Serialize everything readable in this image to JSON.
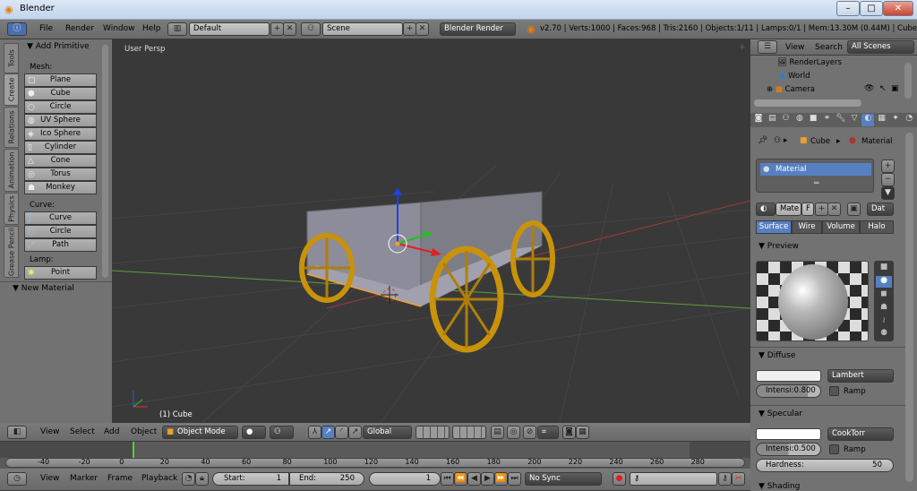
{
  "window": {
    "title": "Blender",
    "controls": [
      "–",
      "□",
      "✕"
    ]
  },
  "info_header": {
    "menus": [
      "File",
      "Render",
      "Window",
      "Help"
    ],
    "layout": "Default",
    "scene": "Scene",
    "engine": "Blender Render",
    "stats": "v2.70 | Verts:1000 | Faces:968 | Tris:2160 | Objects:1/11 | Lamps:0/1 | Mem:13.30M (0.44M) | Cube"
  },
  "tool_shelf": {
    "tabs": [
      "Tools",
      "Create",
      "Relations",
      "Animation",
      "Physics",
      "Grease Pencil"
    ],
    "active_tab": "Create",
    "panel_title": "Add Primitive",
    "mesh_label": "Mesh:",
    "mesh": [
      "Plane",
      "Cube",
      "Circle",
      "UV Sphere",
      "Ico Sphere",
      "Cylinder",
      "Cone",
      "Torus",
      "Monkey"
    ],
    "curve_label": "Curve:",
    "curve": [
      "Curve",
      "Circle",
      "Path"
    ],
    "lamp_label": "Lamp:",
    "lamp": [
      "Point"
    ],
    "new_material": "New Material"
  },
  "viewport": {
    "view_name": "User Persp",
    "object_label": "(1) Cube",
    "colors": {
      "background": "#393939",
      "wood_wheel": "#c8920a",
      "wagon_body": "#8c8c9a"
    }
  },
  "view3d_header": {
    "menus": [
      "View",
      "Select",
      "Add",
      "Object"
    ],
    "mode": "Object Mode",
    "orientation": "Global"
  },
  "timeline": {
    "ticks": [
      "-40",
      "-20",
      "0",
      "20",
      "40",
      "60",
      "80",
      "100",
      "120",
      "140",
      "160",
      "180",
      "200",
      "220",
      "240",
      "260",
      "280"
    ],
    "current_frame_marker": 0,
    "header": {
      "menus": [
        "View",
        "Marker",
        "Frame",
        "Playback"
      ],
      "start_label": "Start:",
      "start": "1",
      "end_label": "End:",
      "end": "250",
      "current": "1",
      "sync": "No Sync"
    }
  },
  "outliner": {
    "menus": [
      "View",
      "Search"
    ],
    "filter": "All Scenes",
    "items": [
      "RenderLayers",
      "World",
      "Camera"
    ]
  },
  "properties": {
    "breadcrumb": [
      "Cube",
      "Material"
    ],
    "material_slot": "Material",
    "material_name": "Mate",
    "fake_user": "F",
    "data_link": "Dat",
    "tabs": [
      "Surface",
      "Wire",
      "Volume",
      "Halo"
    ],
    "active_tab": "Surface",
    "preview_title": "Preview",
    "diffuse": {
      "title": "Diffuse",
      "shader": "Lambert",
      "intensity": "Intensi:0.800",
      "intensity_value": 0.8,
      "ramp": "Ramp",
      "color": "#f0f0f0"
    },
    "specular": {
      "title": "Specular",
      "shader": "CookTorr",
      "intensity": "Intensi:0.500",
      "intensity_value": 0.5,
      "ramp": "Ramp",
      "hardness_label": "Hardness:",
      "hardness": "50",
      "color": "#ffffff"
    },
    "shading_title": "Shading"
  }
}
